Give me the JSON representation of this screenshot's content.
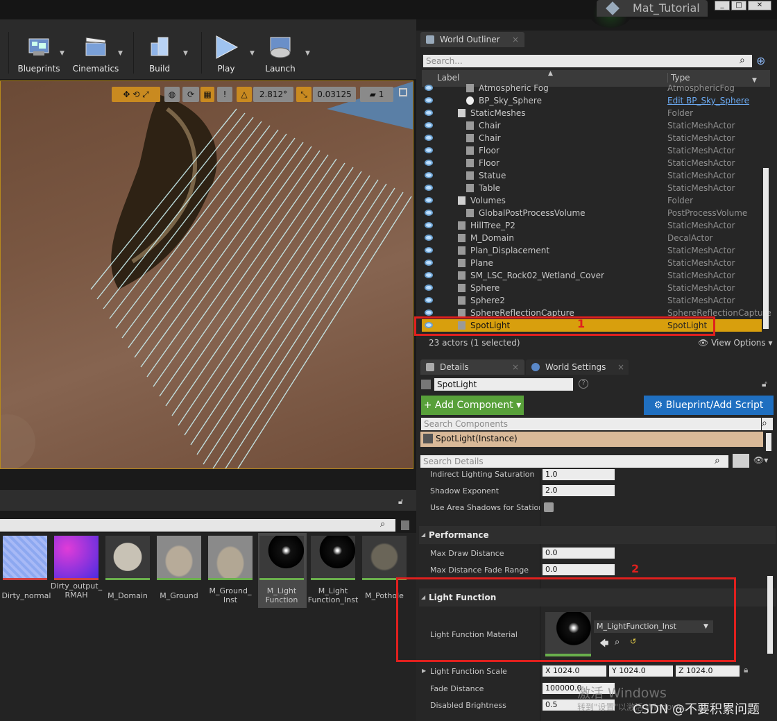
{
  "window": {
    "title": "Mat_Tutorial",
    "buttons": [
      "_",
      "□",
      "✕"
    ]
  },
  "toolbar": {
    "items": [
      {
        "label": "Blueprints",
        "icon": "blueprints-icon"
      },
      {
        "label": "Cinematics",
        "icon": "clapperboard-icon"
      },
      {
        "label": "Build",
        "icon": "build-blocks-icon"
      },
      {
        "label": "Play",
        "icon": "play-icon"
      },
      {
        "label": "Launch",
        "icon": "gamepad-icon"
      }
    ]
  },
  "viewport": {
    "angle_snap": "2.812°",
    "scale_snap": "0.03125",
    "camera_speed": "1"
  },
  "content_browser": {
    "assets": [
      {
        "label": "Dirty_normal"
      },
      {
        "label": "Dirty_output_\nRMAH"
      },
      {
        "label": "M_Domain"
      },
      {
        "label": "M_Ground"
      },
      {
        "label": "M_Ground_\nInst"
      },
      {
        "label": "M_Light\nFunction"
      },
      {
        "label": "M_Light\nFunction_Inst"
      },
      {
        "label": "M_Pothole"
      }
    ]
  },
  "world_outliner": {
    "tab": "World Outliner",
    "search_placeholder": "Search...",
    "col_label": "Label",
    "col_type": "Type",
    "rows": [
      {
        "label": "Atmospheric Fog",
        "type": "AtmosphericFog"
      },
      {
        "label": "BP_Sky_Sphere",
        "type": "Edit BP_Sky_Sphere"
      },
      {
        "label": "StaticMeshes",
        "type": "Folder"
      },
      {
        "label": "Chair",
        "type": "StaticMeshActor"
      },
      {
        "label": "Chair",
        "type": "StaticMeshActor"
      },
      {
        "label": "Floor",
        "type": "StaticMeshActor"
      },
      {
        "label": "Floor",
        "type": "StaticMeshActor"
      },
      {
        "label": "Statue",
        "type": "StaticMeshActor"
      },
      {
        "label": "Table",
        "type": "StaticMeshActor"
      },
      {
        "label": "Volumes",
        "type": "Folder"
      },
      {
        "label": "GlobalPostProcessVolume",
        "type": "PostProcessVolume"
      },
      {
        "label": "HillTree_P2",
        "type": "StaticMeshActor"
      },
      {
        "label": "M_Domain",
        "type": "DecalActor"
      },
      {
        "label": "Plan_Displacement",
        "type": "StaticMeshActor"
      },
      {
        "label": "Plane",
        "type": "StaticMeshActor"
      },
      {
        "label": "SM_LSC_Rock02_Wetland_Cover",
        "type": "StaticMeshActor"
      },
      {
        "label": "Sphere",
        "type": "StaticMeshActor"
      },
      {
        "label": "Sphere2",
        "type": "StaticMeshActor"
      },
      {
        "label": "SphereReflectionCapture",
        "type": "SphereReflectionCapture"
      },
      {
        "label": "SpotLight",
        "type": "SpotLight"
      }
    ],
    "actor_count": "23 actors (1 selected)",
    "view_options": "View Options"
  },
  "details": {
    "tab": "Details",
    "tab2": "World Settings",
    "name": "SpotLight",
    "add_component": "Add Component",
    "blueprint_script": "Blueprint/Add Script",
    "search_components": "Search Components",
    "instance": "SpotLight(Instance)",
    "search_details": "Search Details",
    "props": {
      "indirect_sat_label": "Indirect Lighting Saturation",
      "indirect_sat": "1.0",
      "shadow_exp_label": "Shadow Exponent",
      "shadow_exp": "2.0",
      "area_shadows_label": "Use Area Shadows for Stationar"
    },
    "performance": {
      "title": "Performance",
      "max_draw_label": "Max Draw Distance",
      "max_draw": "0.0",
      "fade_range_label": "Max Distance Fade Range",
      "fade_range": "0.0"
    },
    "light_function": {
      "title": "Light Function",
      "material_label": "Light Function Material",
      "material": "M_LightFunction_Inst",
      "scale_label": "Light Function Scale",
      "scale_x": "X  1024.0",
      "scale_y": "Y  1024.0",
      "scale_z": "Z  1024.0",
      "fade_label": "Fade Distance",
      "fade": "100000.0",
      "disabled_label": "Disabled Brightness",
      "disabled": "0.5"
    }
  },
  "annotations": {
    "one": "1",
    "two": "2"
  },
  "watermark": {
    "windows": "激活 Windows",
    "goto": "转到\"设置\"以激活 Windows。",
    "csdn": "CSDN @不要积累问题"
  }
}
